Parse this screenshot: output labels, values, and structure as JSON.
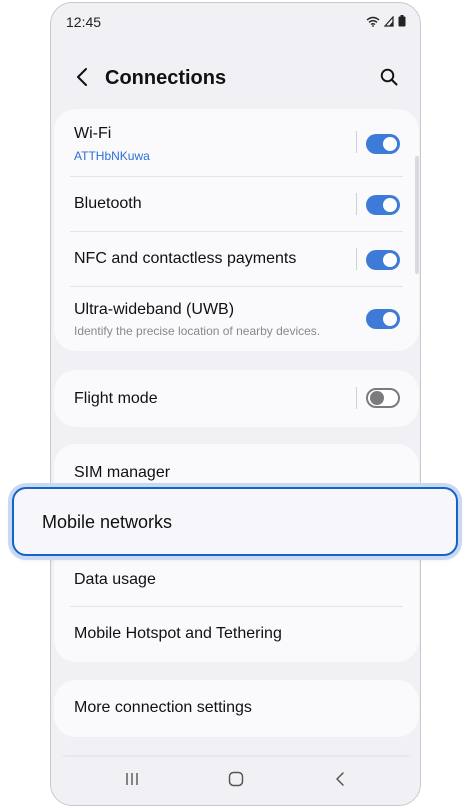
{
  "status_bar": {
    "time": "12:45",
    "icons": [
      "wifi-icon",
      "signal-icon",
      "battery-icon"
    ]
  },
  "app_bar": {
    "title": "Connections",
    "back_icon": "back-arrow-icon",
    "search_icon": "search-icon"
  },
  "group1": {
    "items": [
      {
        "title": "Wi-Fi",
        "subtitle": "ATTHbNKuwa",
        "toggle": true
      },
      {
        "title": "Bluetooth",
        "toggle": true
      },
      {
        "title": "NFC and contactless payments",
        "toggle": true
      },
      {
        "title": "Ultra-wideband (UWB)",
        "subtitle": "Identify the precise location of nearby devices.",
        "toggle": true
      }
    ]
  },
  "group2": {
    "items": [
      {
        "title": "Flight mode",
        "toggle": false
      }
    ]
  },
  "group3": {
    "items": [
      {
        "title": "SIM manager"
      },
      {
        "title": "Mobile networks",
        "highlighted": true
      },
      {
        "title": "Data usage"
      },
      {
        "title": "Mobile Hotspot and Tethering"
      }
    ]
  },
  "group4": {
    "items": [
      {
        "title": "More connection settings"
      }
    ]
  },
  "nav_bar": {
    "icons": [
      "recents-icon",
      "home-icon",
      "back-icon"
    ]
  },
  "colors": {
    "accent": "#3e7bd8",
    "highlight_border": "#1463c9",
    "subtitle_blue": "#2a6fd6",
    "background": "#f1f1f5",
    "card": "#fafafc"
  }
}
